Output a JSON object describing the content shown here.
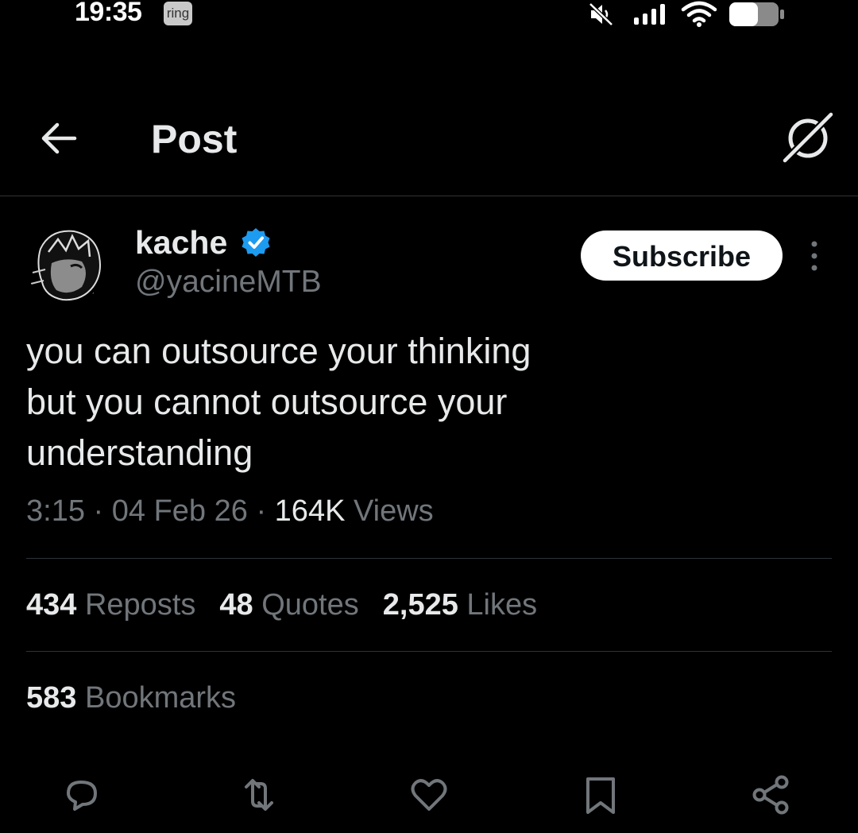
{
  "status_bar": {
    "time": "19:35",
    "ring_badge": "ring"
  },
  "header": {
    "title": "Post"
  },
  "post": {
    "author_name": "kache",
    "author_handle": "@yacineMTB",
    "subscribe_label": "Subscribe",
    "text_lines": [
      "you can outsource your thinking",
      "but you cannot outsource your",
      "understanding"
    ],
    "time": "3:15",
    "date": "04 Feb 26",
    "views_count": "164K",
    "views_label": "Views",
    "separator": "·"
  },
  "stats": {
    "reposts_count": "434",
    "reposts_label": "Reposts",
    "quotes_count": "48",
    "quotes_label": "Quotes",
    "likes_count": "2,525",
    "likes_label": "Likes",
    "bookmarks_count": "583",
    "bookmarks_label": "Bookmarks"
  },
  "icons": {
    "back": "arrow-left-icon",
    "grok": "grok-icon",
    "verified": "verified-badge-icon",
    "more": "more-vertical-icon",
    "reply": "reply-icon",
    "repost": "repost-icon",
    "like": "heart-icon",
    "bookmark": "bookmark-icon",
    "share": "share-icon"
  },
  "colors": {
    "background": "#000000",
    "text": "#e7e9ea",
    "muted": "#71767b",
    "verified": "#1d9bf0",
    "divider": "#2f3336"
  }
}
